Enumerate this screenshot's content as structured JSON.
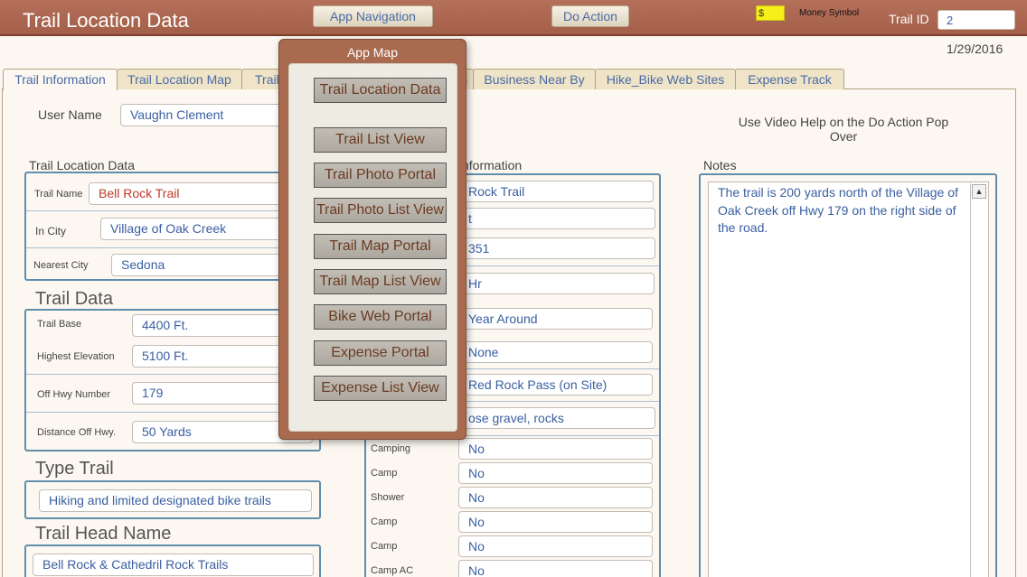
{
  "header": {
    "app_title": "Trail Location Data",
    "nav_button": "App Navigation",
    "action_button": "Do Action",
    "money_value": "$",
    "money_label": "Money Symbol",
    "trail_id_label": "Trail ID",
    "trail_id_value": "2"
  },
  "date": "1/29/2016",
  "tabs": [
    {
      "label": "Trail Information"
    },
    {
      "label": "Trail Location Map"
    },
    {
      "label": "Trail"
    },
    {
      "label": "s"
    },
    {
      "label": "Business Near By"
    },
    {
      "label": "Hike_Bike Web Sites"
    },
    {
      "label": "Expense Track"
    }
  ],
  "user": {
    "label": "User Name",
    "value": "Vaughn Clement"
  },
  "help_text": "Use Video Help on the Do Action Pop Over",
  "location": {
    "title": "Trail Location Data",
    "trail_name_label": "Trail Name",
    "trail_name": "Bell Rock Trail",
    "in_city_label": "In City",
    "in_city": "Village of Oak Creek",
    "nearest_city_label": "Nearest City",
    "nearest_city": "Sedona"
  },
  "trail_data": {
    "title": "Trail Data",
    "base_label": "Trail Base",
    "base_value": "4400 Ft.",
    "highest_label": "Highest Elevation",
    "highest_value": "5100 Ft.",
    "hwy_label": "Off Hwy Number",
    "hwy_value": "179",
    "distance_label": "Distance Off Hwy.",
    "distance_value": "50 Yards"
  },
  "type_trail": {
    "title": "Type Trail",
    "value": "Hiking and limited designated bike trails"
  },
  "trail_head": {
    "title": "Trail Head Name",
    "value": "Bell Rock & Cathedril Rock Trails"
  },
  "middle": {
    "title_partial": "nformation",
    "values": [
      "Rock Trail",
      "t",
      "351",
      "Hr",
      "Year Around",
      "None",
      "Red Rock Pass (on Site)",
      "ose gravel, rocks"
    ],
    "rows": [
      {
        "label": "Camping",
        "value": "No"
      },
      {
        "label": "Camp",
        "value": "No"
      },
      {
        "label": "Shower",
        "value": "No"
      },
      {
        "label": "Camp",
        "value": "No"
      },
      {
        "label": "Camp",
        "value": "No"
      },
      {
        "label": "Camp AC",
        "value": "No"
      }
    ]
  },
  "notes": {
    "label": "Notes",
    "text": "The trail is 200 yards north of the Village of Oak Creek off Hwy 179 on the right side of the road."
  },
  "popover": {
    "title": "App Map",
    "buttons": [
      "Trail Location Data",
      "Trail List View",
      "Trail Photo Portal",
      "Trail Photo List View",
      "Trail Map Portal",
      "Trail Map List View",
      "Bike Web Portal",
      "Expense Portal",
      "Expense List View"
    ]
  }
}
